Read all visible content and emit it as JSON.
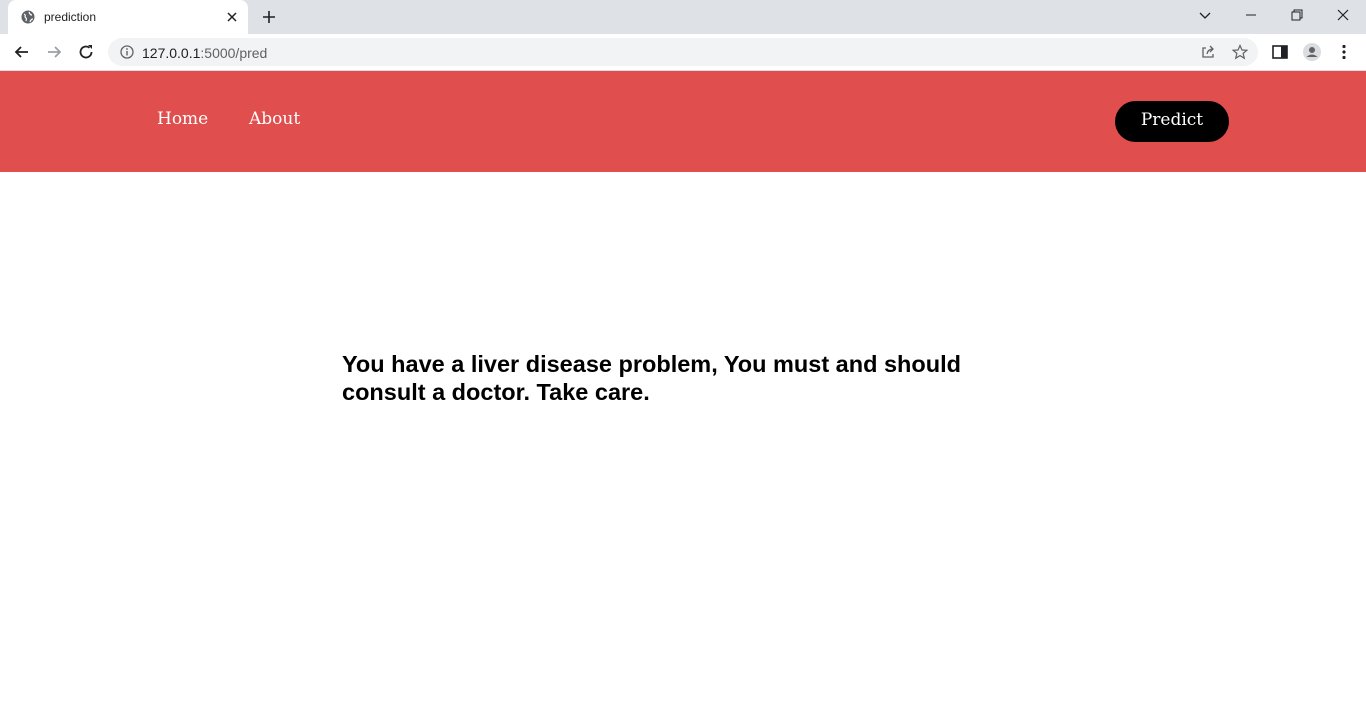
{
  "browser": {
    "tab_title": "prediction",
    "url_host": "127.0.0.1",
    "url_path": ":5000/pred",
    "icons": [
      "globe-icon",
      "close-icon",
      "plus-icon",
      "chevron-down-icon",
      "minimize-icon",
      "restore-icon",
      "window-close-icon",
      "back-icon",
      "forward-icon",
      "reload-icon",
      "info-icon",
      "share-icon",
      "star-icon",
      "sidepanel-icon",
      "profile-icon",
      "kebab-menu-icon"
    ]
  },
  "navbar": {
    "bg_color": "#e04e4e",
    "links": [
      {
        "label": "Home"
      },
      {
        "label": "About"
      }
    ],
    "predict_label": "Predict"
  },
  "result": {
    "message": "You have a liver disease problem, You must and should consult a doctor. Take care."
  }
}
